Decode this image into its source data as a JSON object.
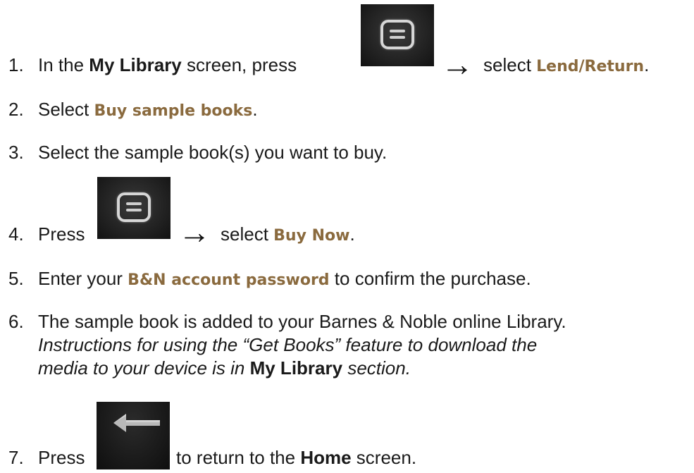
{
  "steps": [
    {
      "num": "1.",
      "pre": "In the ",
      "bold": "My Library",
      "mid": " screen, press",
      "post_a": "select ",
      "kw": "Lend/Return",
      "end": "."
    },
    {
      "num": "2.",
      "pre": "Select ",
      "kw": "Buy sample books",
      "end": "."
    },
    {
      "num": "3.",
      "text": "Select the sample book(s) you want to buy."
    },
    {
      "num": "4.",
      "pre": "Press",
      "post_a": "select ",
      "kw": "Buy Now",
      "end": "."
    },
    {
      "num": "5.",
      "pre": "Enter your ",
      "kw": "B&N account password",
      "post": " to confirm the purchase."
    },
    {
      "num": "6.",
      "text": "The sample book is added to your Barnes & Noble online Library.",
      "italic_1": "Instructions for using the “Get Books” feature to download the",
      "italic_2": "media to your device is in ",
      "bold": "My Library",
      "italic_3": " section."
    },
    {
      "num": "7.",
      "pre": "Press",
      "post": "to return to the ",
      "bold": "Home",
      "end": " screen."
    }
  ],
  "arrow_glyph": "→",
  "icons": {
    "menu": "menu-icon",
    "back": "back-arrow-icon"
  }
}
